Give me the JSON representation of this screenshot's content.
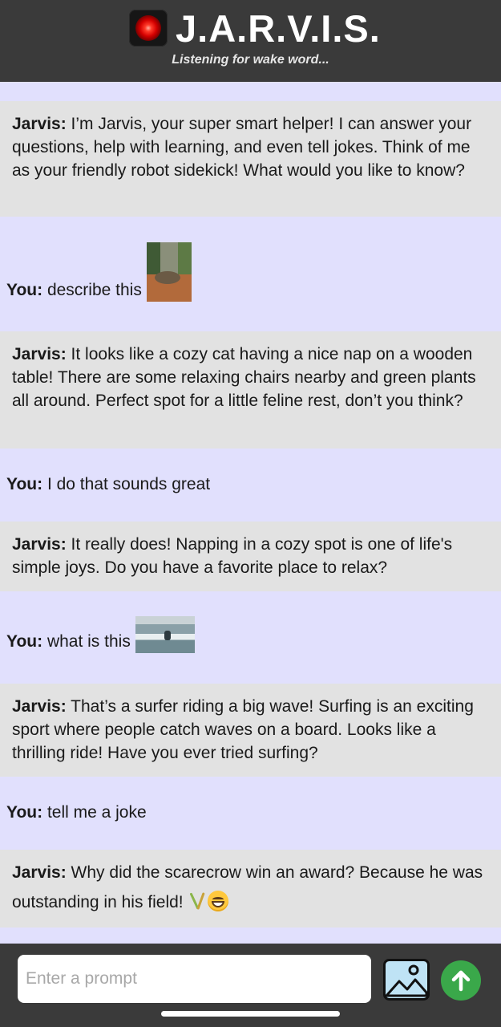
{
  "header": {
    "title": "J.A.R.V.I.S.",
    "status": "Listening for wake word..."
  },
  "messages": [
    {
      "speaker": "Jarvis:",
      "text": " I’m Jarvis, your super smart helper! I can answer your questions, help with learning, and even tell jokes. Think of me as your friendly robot sidekick! What would you like to know?"
    },
    {
      "speaker": "You:",
      "text": " describe this",
      "image": "cat-photo-thumbnail"
    },
    {
      "speaker": "Jarvis:",
      "text": " It looks like a cozy cat having a nice nap on a wooden table! There are some relaxing chairs nearby and green plants all around. Perfect spot for a little feline rest, don’t you think?"
    },
    {
      "speaker": "You:",
      "text": " I do that sounds great"
    },
    {
      "speaker": "Jarvis:",
      "text": " It really does! Napping in a cozy spot is one of life's simple joys. Do you have a favorite place to relax?"
    },
    {
      "speaker": "You:",
      "text": " what is this",
      "image": "surfer-photo-thumbnail"
    },
    {
      "speaker": "Jarvis:",
      "text": " That’s a surfer riding a big wave! Surfing is an exciting sport where people catch waves on a board. Looks like a thrilling ride! Have you ever tried surfing?"
    },
    {
      "speaker": "You:",
      "text": " tell me a joke"
    },
    {
      "speaker": "Jarvis:",
      "text": " Why did the scarecrow win an award? Because he was outstanding in his field!",
      "emoji": [
        "sheaf-of-rice",
        "grinning-face"
      ]
    }
  ],
  "input": {
    "placeholder": "Enter a prompt",
    "value": ""
  },
  "icons": {
    "logo": "red-eye-icon",
    "image_button": "image-icon",
    "send_button": "arrow-up-icon"
  },
  "colors": {
    "header_bg": "#3a3a3a",
    "jarvis_bg": "#e2e2e2",
    "user_bg": "#e1e0fd",
    "send_button": "#3aa84a"
  }
}
